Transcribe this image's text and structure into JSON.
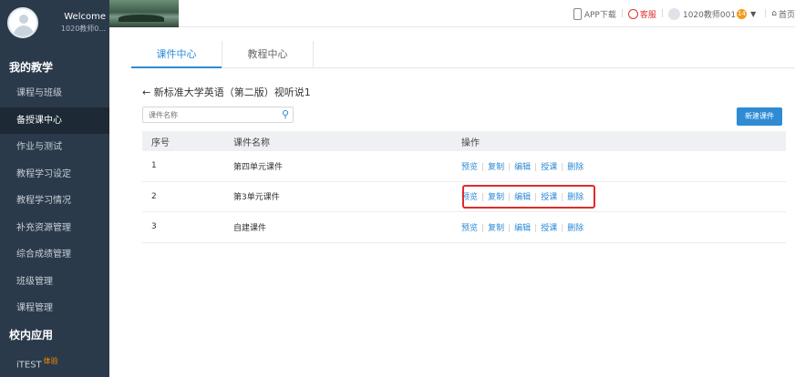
{
  "sidebar": {
    "welcome": "Welcome",
    "username": "1020教师0...",
    "group1_title": "我的教学",
    "items": [
      {
        "label": "课程与班级"
      },
      {
        "label": "备授课中心"
      },
      {
        "label": "作业与测试"
      },
      {
        "label": "教程学习设定"
      },
      {
        "label": "教程学习情况"
      },
      {
        "label": "补充资源管理"
      },
      {
        "label": "综合成绩管理"
      },
      {
        "label": "班级管理"
      },
      {
        "label": "课程管理"
      }
    ],
    "active_index": 1,
    "group2_title": "校内应用",
    "app_item": {
      "label": "iTEST",
      "badge": "体验"
    }
  },
  "topbar": {
    "app_download": "APP下载",
    "service": "客服",
    "user": "1020教师001",
    "msg_count": "14",
    "home": "首页"
  },
  "tabs": [
    "课件中心",
    "教程中心"
  ],
  "page_title": "← 新标准大学英语（第二版）视听说1",
  "search": {
    "placeholder": "课件名称"
  },
  "new_button": "新建课件",
  "table": {
    "headers": [
      "序号",
      "课件名称",
      "操作"
    ],
    "rows": [
      {
        "index": "1",
        "name": "第四单元课件"
      },
      {
        "index": "2",
        "name": "第3单元课件"
      },
      {
        "index": "3",
        "name": "自建课件"
      }
    ],
    "actions": [
      "预览",
      "复制",
      "编辑",
      "授课",
      "删除"
    ]
  },
  "colors": {
    "accent": "#2e8bd4",
    "sidebar": "#2b3a4a",
    "highlight": "#e02a2a"
  }
}
